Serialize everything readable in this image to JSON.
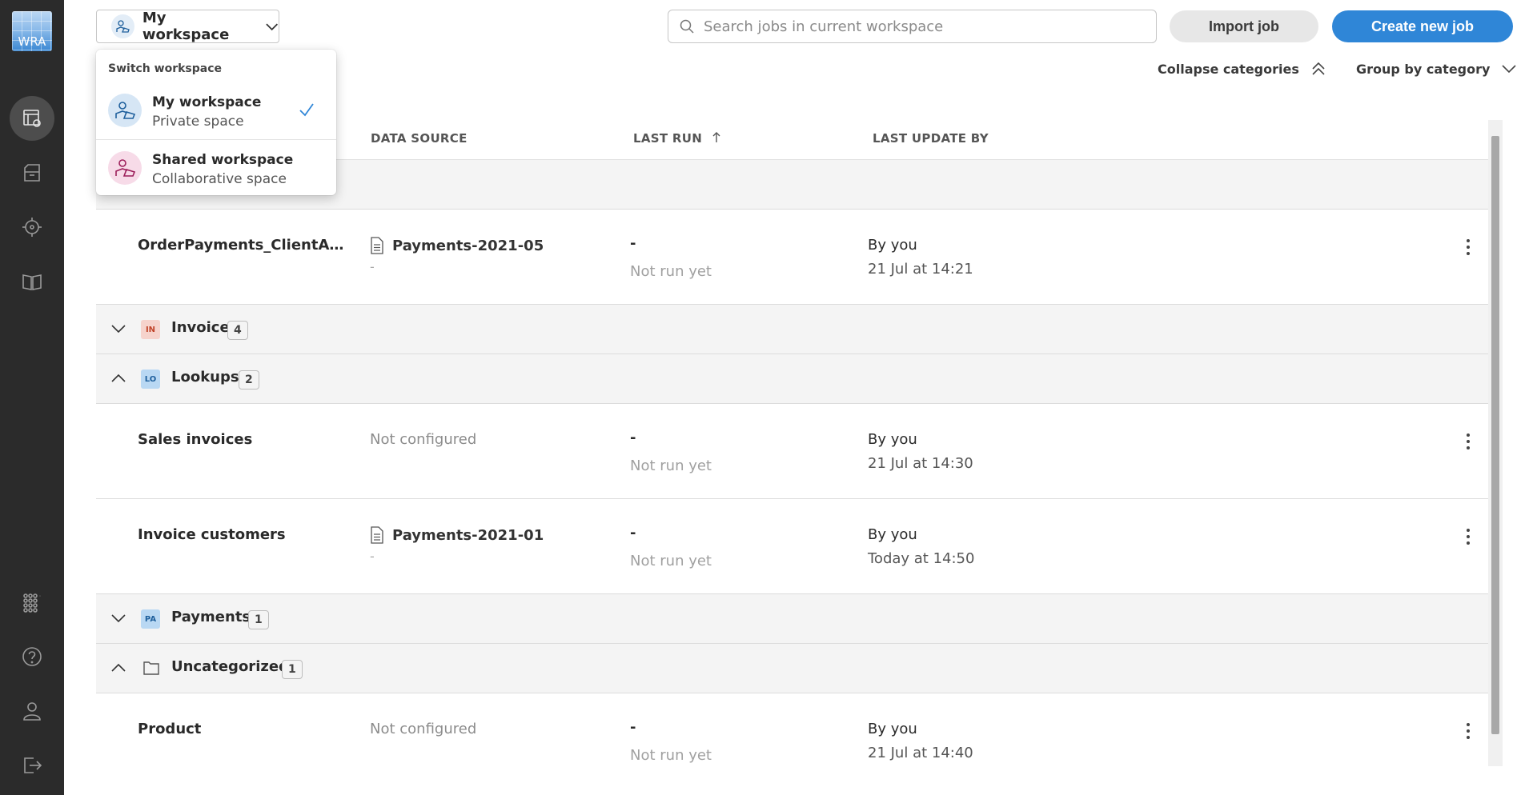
{
  "app": {
    "logo_text": "WRA"
  },
  "rail": {
    "items": [
      {
        "icon": "jobs-table-icon",
        "active": true
      },
      {
        "icon": "archive-icon",
        "active": false
      },
      {
        "icon": "target-icon",
        "active": false
      },
      {
        "icon": "book-icon",
        "active": false
      }
    ],
    "bottom": [
      {
        "icon": "apps-grid-icon"
      },
      {
        "icon": "help-icon"
      },
      {
        "icon": "user-icon"
      },
      {
        "icon": "logout-icon"
      }
    ]
  },
  "header": {
    "workspace_label": "My workspace",
    "search_placeholder": "Search jobs in current workspace",
    "import_label": "Import job",
    "create_label": "Create new job",
    "collapse_label": "Collapse categories",
    "group_label": "Group by category"
  },
  "table": {
    "columns": {
      "data_source": "DATA SOURCE",
      "last_run": "LAST RUN",
      "last_update": "LAST UPDATE BY"
    },
    "rows": [
      {
        "kind": "job",
        "name": "OrderPayments_ClientA Ori...",
        "ds": "Payments-2021-05",
        "ds_sub": "-",
        "ds_has_icon": true,
        "last_run": "-",
        "last_run_sub": "Not run yet",
        "updated_by": "By you",
        "updated_at": "21 Jul at 14:21"
      },
      {
        "kind": "cat",
        "name": "Invoice",
        "count": "4",
        "badge": "IN",
        "expanded": false
      },
      {
        "kind": "cat",
        "name": "Lookups",
        "count": "2",
        "badge": "LO",
        "expanded": true
      },
      {
        "kind": "job",
        "name": "Sales invoices",
        "ds": "Not configured",
        "ds_sub": "",
        "ds_has_icon": false,
        "last_run": "-",
        "last_run_sub": "Not run yet",
        "updated_by": "By you",
        "updated_at": "21 Jul at 14:30"
      },
      {
        "kind": "job",
        "name": "Invoice customers",
        "ds": "Payments-2021-01",
        "ds_sub": "-",
        "ds_has_icon": true,
        "last_run": "-",
        "last_run_sub": "Not run yet",
        "updated_by": "By you",
        "updated_at": "Today at 14:50"
      },
      {
        "kind": "cat",
        "name": "Payments",
        "count": "1",
        "badge": "PA",
        "expanded": false
      },
      {
        "kind": "cat",
        "name": "Uncategorized",
        "count": "1",
        "badge": "",
        "expanded": true
      },
      {
        "kind": "job",
        "name": "Product",
        "ds": "Not configured",
        "ds_sub": "",
        "ds_has_icon": false,
        "last_run": "-",
        "last_run_sub": "Not run yet",
        "updated_by": "By you",
        "updated_at": "21 Jul at 14:40"
      }
    ]
  },
  "dropdown": {
    "title": "Switch workspace",
    "items": [
      {
        "name": "My workspace",
        "sub": "Private space",
        "selected": true
      },
      {
        "name": "Shared workspace",
        "sub": "Collaborative space",
        "selected": false
      }
    ]
  },
  "colors": {
    "accent": "#2f86d7",
    "rail_bg": "#2b2b2b",
    "badge_invoice_bg": "#f6d3cc",
    "badge_invoice_fg": "#c0442a",
    "badge_lookups_bg": "#b9d8f3",
    "badge_lookups_fg": "#1e5f9c",
    "badge_payments_bg": "#b9d8f3",
    "badge_payments_fg": "#1e5f9c"
  }
}
